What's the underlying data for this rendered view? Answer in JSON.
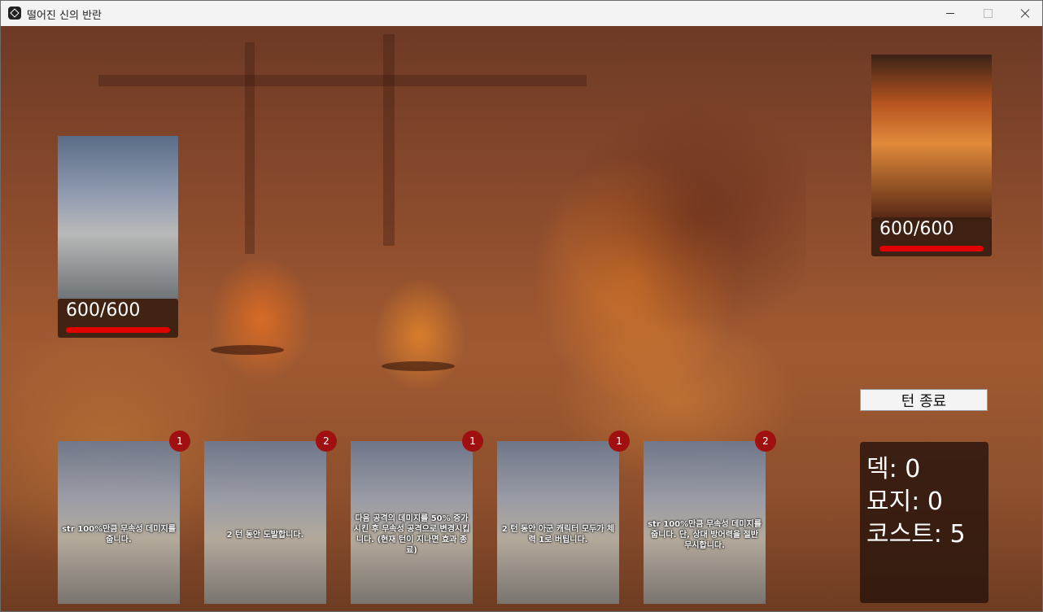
{
  "window": {
    "title": "떨어진 신의 반란"
  },
  "player": {
    "hp_text": "600/600",
    "hp_fraction": 1.0
  },
  "enemy": {
    "hp_text": "600/600",
    "hp_fraction": 1.0
  },
  "hand": [
    {
      "cost": "1",
      "text": "str 100%만큼 무속성 데미지를 줍니다."
    },
    {
      "cost": "2",
      "text": "2 턴 동안 도발합니다."
    },
    {
      "cost": "1",
      "text": "다음 공격의 데미지를 50% 증가시킨 후 무속성 공격으로 변경시킵니다. (현재 턴이 지나면 효과 종료)"
    },
    {
      "cost": "1",
      "text": "2 턴 동안 아군 캐릭터 모두가 체력 1로 버팁니다."
    },
    {
      "cost": "2",
      "text": "str 100%만큼 무속성 데미지를 줍니다. 단, 상대 방어력을 절반 무시합니다."
    }
  ],
  "controls": {
    "end_turn_label": "턴 종료"
  },
  "stats": {
    "deck": "덱: 0",
    "grave": "묘지: 0",
    "cost": "코스트: 5"
  }
}
